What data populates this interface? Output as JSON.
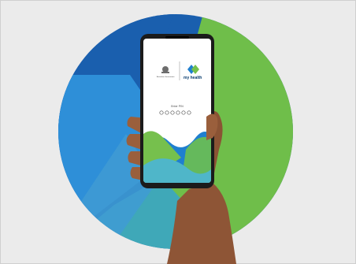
{
  "illustration": {
    "colors": {
      "background": "#ebebeb",
      "circle_dark_blue": "#1a5fae",
      "circle_light_blue": "#2e8fd8",
      "circle_green": "#6fbe4a",
      "circle_teal": "#3fa8b8",
      "skin": "#9a5f3c",
      "phone_frame": "#1b1b1b"
    }
  },
  "phone_screen": {
    "government_logo_label": "Australian Government",
    "app_name": "my health",
    "pin_prompt": "Enter PIN",
    "pin_dot_count": 6
  }
}
